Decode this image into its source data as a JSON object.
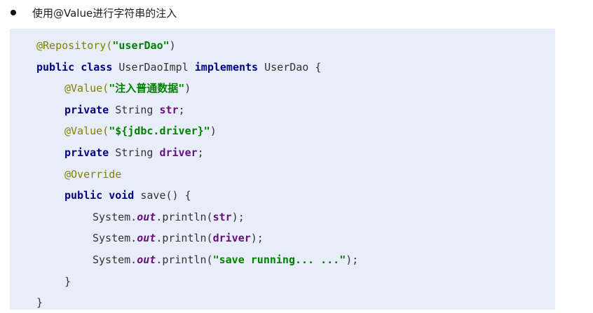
{
  "heading": {
    "text": "使用@Value进行字符串的注入"
  },
  "code": {
    "lines": [
      {
        "indent": 0,
        "tokens": [
          {
            "t": "@Repository(",
            "c": "ann"
          },
          {
            "t": "\"userDao\"",
            "c": "str"
          },
          {
            "t": ")",
            "c": "plain"
          }
        ]
      },
      {
        "indent": 0,
        "tokens": [
          {
            "t": "public class",
            "c": "kw"
          },
          {
            "t": " UserDaoImpl ",
            "c": "plain"
          },
          {
            "t": "implements",
            "c": "kw"
          },
          {
            "t": " UserDao {",
            "c": "plain"
          }
        ]
      },
      {
        "indent": 1,
        "tokens": [
          {
            "t": "@Value(",
            "c": "ann"
          },
          {
            "t": "\"注入普通数据\"",
            "c": "str"
          },
          {
            "t": ")",
            "c": "plain"
          }
        ]
      },
      {
        "indent": 1,
        "tokens": [
          {
            "t": "private",
            "c": "kw"
          },
          {
            "t": " String ",
            "c": "plain"
          },
          {
            "t": "str",
            "c": "fld"
          },
          {
            "t": ";",
            "c": "plain"
          }
        ]
      },
      {
        "indent": 1,
        "tokens": [
          {
            "t": "@Value(",
            "c": "ann"
          },
          {
            "t": "\"${jdbc.driver}\"",
            "c": "str"
          },
          {
            "t": ")",
            "c": "plain"
          }
        ]
      },
      {
        "indent": 1,
        "tokens": [
          {
            "t": "private",
            "c": "kw"
          },
          {
            "t": " String ",
            "c": "plain"
          },
          {
            "t": "driver",
            "c": "fld"
          },
          {
            "t": ";",
            "c": "plain"
          }
        ]
      },
      {
        "indent": 1,
        "tokens": [
          {
            "t": "@Override",
            "c": "ann"
          }
        ]
      },
      {
        "indent": 1,
        "tokens": [
          {
            "t": "public void",
            "c": "kw"
          },
          {
            "t": " save() {",
            "c": "plain"
          }
        ]
      },
      {
        "indent": 2,
        "tokens": [
          {
            "t": "System.",
            "c": "plain"
          },
          {
            "t": "out",
            "c": "sfld"
          },
          {
            "t": ".println(",
            "c": "plain"
          },
          {
            "t": "str",
            "c": "fld"
          },
          {
            "t": ");",
            "c": "plain"
          }
        ]
      },
      {
        "indent": 2,
        "tokens": [
          {
            "t": "System.",
            "c": "plain"
          },
          {
            "t": "out",
            "c": "sfld"
          },
          {
            "t": ".println(",
            "c": "plain"
          },
          {
            "t": "driver",
            "c": "fld"
          },
          {
            "t": ");",
            "c": "plain"
          }
        ]
      },
      {
        "indent": 2,
        "tokens": [
          {
            "t": "System.",
            "c": "plain"
          },
          {
            "t": "out",
            "c": "sfld"
          },
          {
            "t": ".println(",
            "c": "plain"
          },
          {
            "t": "\"save running... ...\"",
            "c": "str"
          },
          {
            "t": ");",
            "c": "plain"
          }
        ]
      },
      {
        "indent": 1,
        "tokens": [
          {
            "t": "}",
            "c": "plain"
          }
        ]
      },
      {
        "indent": 0,
        "tokens": [
          {
            "t": "}",
            "c": "plain"
          }
        ]
      }
    ]
  },
  "colors": {
    "code_background": "#e8eef9",
    "annotation": "#808000",
    "string": "#008000",
    "keyword": "#000080",
    "field": "#660e7a"
  }
}
